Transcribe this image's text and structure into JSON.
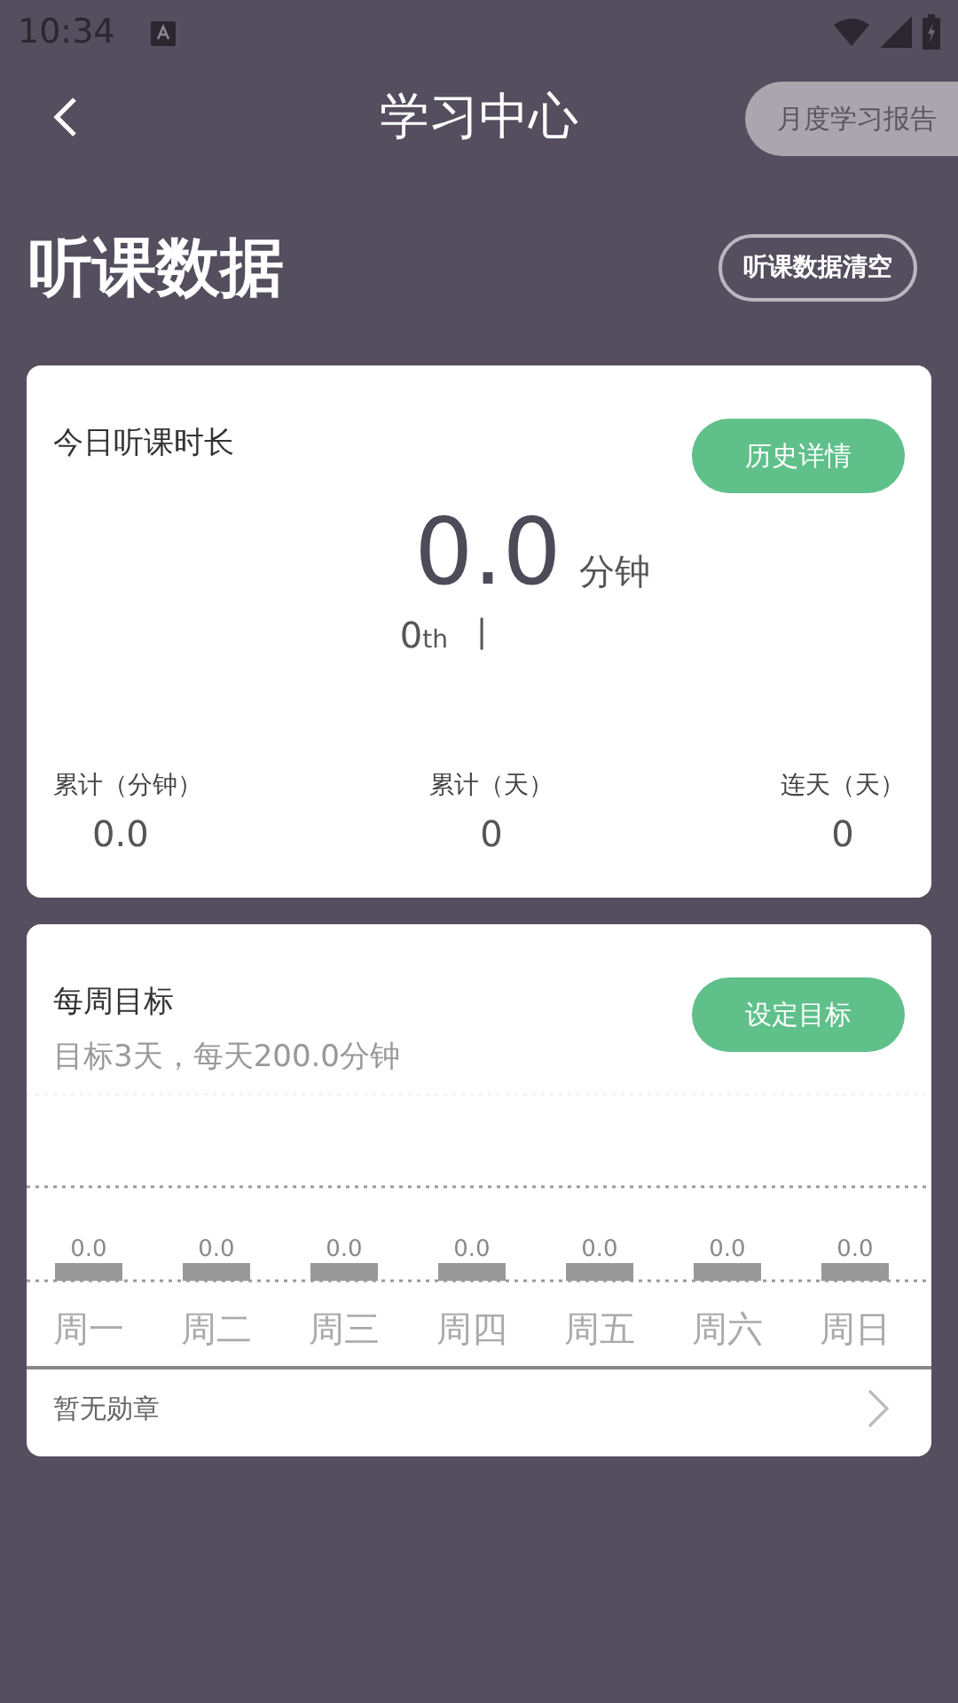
{
  "status_bar": {
    "time": "10:34"
  },
  "header": {
    "title": "学习中心",
    "report_button": "月度学习报告"
  },
  "section": {
    "title": "听课数据",
    "clear_button": "听课数据清空"
  },
  "today_card": {
    "title": "今日听课时长",
    "history_button": "历史详情",
    "value": "0.0",
    "unit": "分钟",
    "rank": "0",
    "rank_suffix": "th",
    "rank_divider": "|",
    "stats": [
      {
        "label": "累计（分钟）",
        "value": "0.0"
      },
      {
        "label": "累计（天）",
        "value": "0"
      },
      {
        "label": "连天（天）",
        "value": "0"
      }
    ]
  },
  "weekly_card": {
    "title": "每周目标",
    "goal_button": "设定目标",
    "goal_text": "目标3天，每天200.0分钟",
    "days": [
      {
        "label": "周一",
        "value": "0.0"
      },
      {
        "label": "周二",
        "value": "0.0"
      },
      {
        "label": "周三",
        "value": "0.0"
      },
      {
        "label": "周四",
        "value": "0.0"
      },
      {
        "label": "周五",
        "value": "0.0"
      },
      {
        "label": "周六",
        "value": "0.0"
      },
      {
        "label": "周日",
        "value": "0.0"
      }
    ],
    "badges_text": "暂无勋章"
  }
}
